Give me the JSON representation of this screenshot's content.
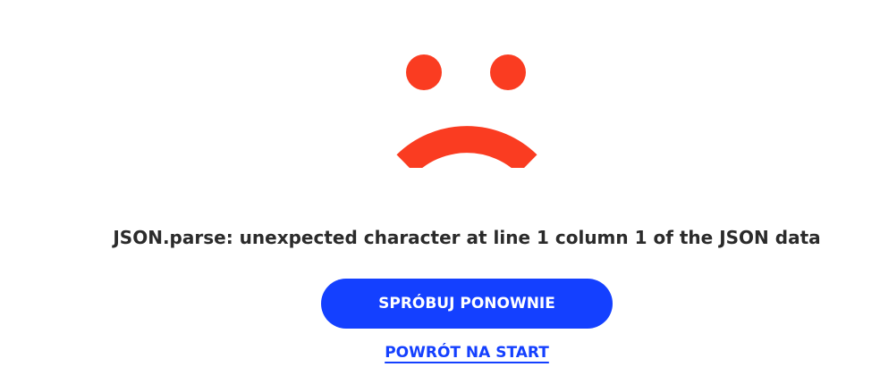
{
  "error": {
    "icon": "sad-face-icon",
    "message": "JSON.parse: unexpected character at line 1 column 1 of the JSON data"
  },
  "actions": {
    "retry_label": "SPRÓBUJ PONOWNIE",
    "back_label": "POWRÓT NA START"
  },
  "colors": {
    "icon": "#fa3c21",
    "primary": "#1440ff",
    "text": "#2b2b2b"
  }
}
